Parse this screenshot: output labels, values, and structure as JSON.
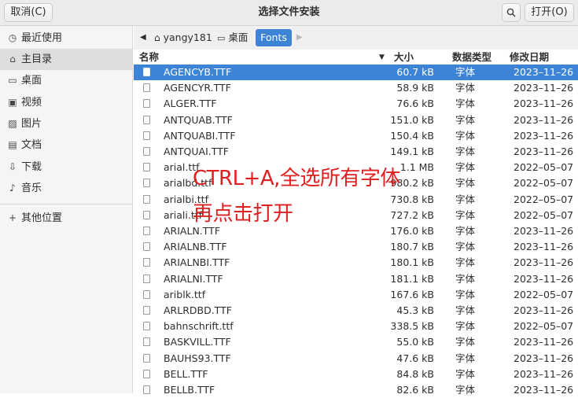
{
  "titlebar": {
    "cancel_label": "取消(C)",
    "title": "选择文件安装",
    "search_icon": "search-icon",
    "open_label": "打开(O)"
  },
  "sidebar": {
    "items": [
      {
        "icon": "clock-icon",
        "glyph": "◷",
        "label": "最近使用"
      },
      {
        "icon": "home-icon",
        "glyph": "⌂",
        "label": "主目录"
      },
      {
        "icon": "desktop-icon",
        "glyph": "▭",
        "label": "桌面"
      },
      {
        "icon": "video-icon",
        "glyph": "▣",
        "label": "视频"
      },
      {
        "icon": "picture-icon",
        "glyph": "▨",
        "label": "图片"
      },
      {
        "icon": "document-icon",
        "glyph": "▤",
        "label": "文档"
      },
      {
        "icon": "download-icon",
        "glyph": "⇩",
        "label": "下载"
      },
      {
        "icon": "music-icon",
        "glyph": "♪",
        "label": "音乐"
      }
    ],
    "other": {
      "icon": "plus-icon",
      "glyph": "+",
      "label": "其他位置"
    }
  },
  "pathbar": {
    "home": "yangy181",
    "desktop": "桌面",
    "fonts": "Fonts"
  },
  "columns": {
    "name": "名称",
    "size": "大小",
    "type": "数据类型",
    "date": "修改日期"
  },
  "files": [
    {
      "name": "AGENCYB.TTF",
      "size": "60.7 kB",
      "type": "字体",
      "date": "2023–11–26"
    },
    {
      "name": "AGENCYR.TTF",
      "size": "58.9 kB",
      "type": "字体",
      "date": "2023–11–26"
    },
    {
      "name": "ALGER.TTF",
      "size": "76.6 kB",
      "type": "字体",
      "date": "2023–11–26"
    },
    {
      "name": "ANTQUAB.TTF",
      "size": "151.0 kB",
      "type": "字体",
      "date": "2023–11–26"
    },
    {
      "name": "ANTQUABI.TTF",
      "size": "150.4 kB",
      "type": "字体",
      "date": "2023–11–26"
    },
    {
      "name": "ANTQUAI.TTF",
      "size": "149.1 kB",
      "type": "字体",
      "date": "2023–11–26"
    },
    {
      "name": "arial.ttf",
      "size": "1.1 MB",
      "type": "字体",
      "date": "2022–05–07"
    },
    {
      "name": "arialbd.ttf",
      "size": "980.2 kB",
      "type": "字体",
      "date": "2022–05–07"
    },
    {
      "name": "arialbi.ttf",
      "size": "730.8 kB",
      "type": "字体",
      "date": "2022–05–07"
    },
    {
      "name": "ariali.ttf",
      "size": "727.2 kB",
      "type": "字体",
      "date": "2022–05–07"
    },
    {
      "name": "ARIALN.TTF",
      "size": "176.0 kB",
      "type": "字体",
      "date": "2023–11–26"
    },
    {
      "name": "ARIALNB.TTF",
      "size": "180.7 kB",
      "type": "字体",
      "date": "2023–11–26"
    },
    {
      "name": "ARIALNBI.TTF",
      "size": "180.1 kB",
      "type": "字体",
      "date": "2023–11–26"
    },
    {
      "name": "ARIALNI.TTF",
      "size": "181.1 kB",
      "type": "字体",
      "date": "2023–11–26"
    },
    {
      "name": "ariblk.ttf",
      "size": "167.6 kB",
      "type": "字体",
      "date": "2022–05–07"
    },
    {
      "name": "ARLRDBD.TTF",
      "size": "45.3 kB",
      "type": "字体",
      "date": "2023–11–26"
    },
    {
      "name": "bahnschrift.ttf",
      "size": "338.5 kB",
      "type": "字体",
      "date": "2022–05–07"
    },
    {
      "name": "BASKVILL.TTF",
      "size": "55.0 kB",
      "type": "字体",
      "date": "2023–11–26"
    },
    {
      "name": "BAUHS93.TTF",
      "size": "47.6 kB",
      "type": "字体",
      "date": "2023–11–26"
    },
    {
      "name": "BELL.TTF",
      "size": "84.8 kB",
      "type": "字体",
      "date": "2023–11–26"
    },
    {
      "name": "BELLB.TTF",
      "size": "82.6 kB",
      "type": "字体",
      "date": "2023–11–26"
    }
  ],
  "annotation": {
    "line1": "CTRL+A,全选所有字体",
    "line2": "再点击打开",
    "color": "#e02020"
  },
  "colors": {
    "selection": "#3e84d6"
  }
}
